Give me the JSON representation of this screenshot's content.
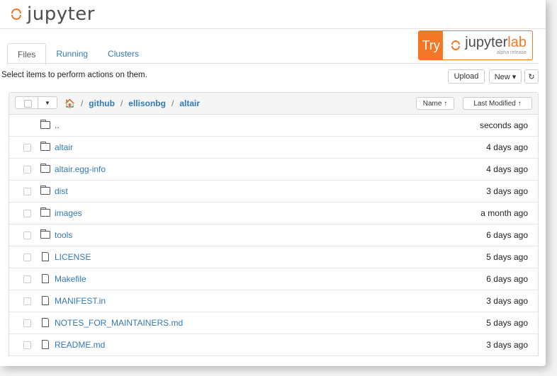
{
  "header": {
    "logo_text": "jupyter"
  },
  "tabs": [
    {
      "label": "Files",
      "active": true
    },
    {
      "label": "Running",
      "active": false
    },
    {
      "label": "Clusters",
      "active": false
    }
  ],
  "try_banner": {
    "try_label": "Try",
    "product": "jupyter",
    "product_suffix": "lab",
    "subtitle": "alpha release"
  },
  "toolbar": {
    "hint": "Select items to perform actions on them.",
    "upload_label": "Upload",
    "new_label": "New ▾",
    "refresh_icon": "↻"
  },
  "breadcrumb": {
    "home_icon": "🏠",
    "parts": [
      "github",
      "ellisonbg",
      "altair"
    ],
    "separator": "/"
  },
  "sort": {
    "name_label": "Name ↑",
    "modified_label": "Last Modified ↑"
  },
  "rows": [
    {
      "name": "..",
      "type": "parent",
      "time": "seconds ago"
    },
    {
      "name": "altair",
      "type": "folder",
      "time": "4 days ago"
    },
    {
      "name": "altair.egg-info",
      "type": "folder",
      "time": "4 days ago"
    },
    {
      "name": "dist",
      "type": "folder",
      "time": "3 days ago"
    },
    {
      "name": "images",
      "type": "folder",
      "time": "a month ago"
    },
    {
      "name": "tools",
      "type": "folder",
      "time": "6 days ago"
    },
    {
      "name": "LICENSE",
      "type": "file",
      "time": "5 days ago"
    },
    {
      "name": "Makefile",
      "type": "file",
      "time": "6 days ago"
    },
    {
      "name": "MANIFEST.in",
      "type": "file",
      "time": "3 days ago"
    },
    {
      "name": "NOTES_FOR_MAINTAINERS.md",
      "type": "file",
      "time": "5 days ago"
    },
    {
      "name": "README.md",
      "type": "file",
      "time": "3 days ago"
    }
  ],
  "colors": {
    "accent": "#f37726",
    "link": "#337ab7"
  }
}
